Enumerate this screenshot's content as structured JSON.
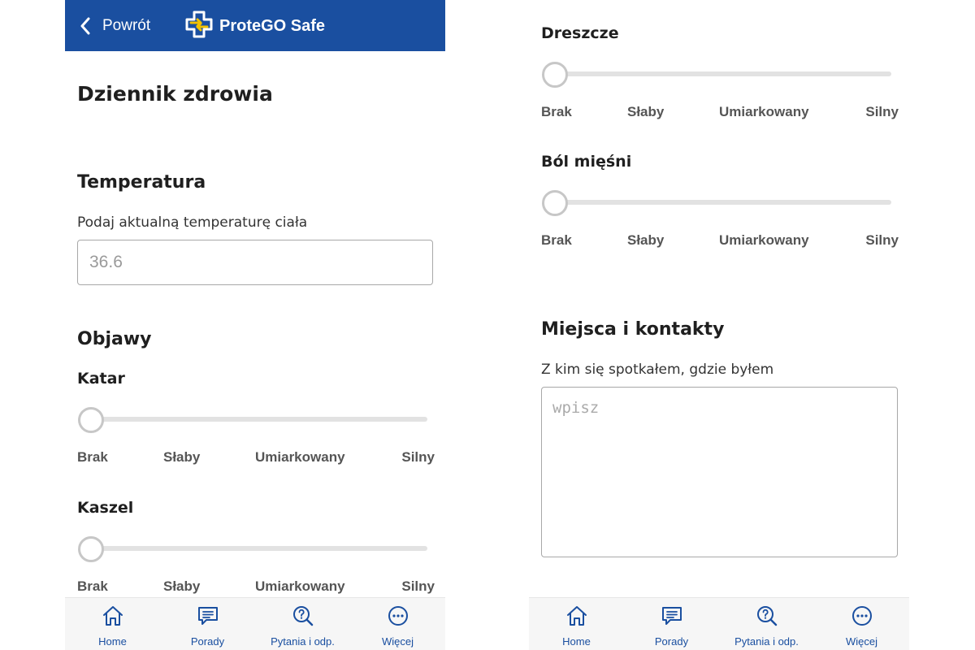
{
  "header": {
    "back_label": "Powrót",
    "logo_text": "ProteGO Safe"
  },
  "page": {
    "title": "Dziennik zdrowia"
  },
  "temperature": {
    "title": "Temperatura",
    "description": "Podaj aktualną temperaturę ciała",
    "placeholder": "36.6",
    "value": ""
  },
  "symptoms": {
    "title": "Objawy",
    "levels": [
      "Brak",
      "Słaby",
      "Umiarkowany",
      "Silny"
    ],
    "items": [
      {
        "name": "Katar",
        "level": 0
      },
      {
        "name": "Kaszel",
        "level": 0
      },
      {
        "name": "Dreszcze",
        "level": 0
      },
      {
        "name": "Ból mięśni",
        "level": 0
      }
    ]
  },
  "contacts": {
    "title": "Miejsca i kontakty",
    "description": "Z kim się spotkałem, gdzie byłem",
    "placeholder": "wpisz",
    "value": ""
  },
  "tabs": [
    {
      "label": "Home",
      "icon": "home-icon"
    },
    {
      "label": "Porady",
      "icon": "chat-icon"
    },
    {
      "label": "Pytania i odp.",
      "icon": "question-search-icon"
    },
    {
      "label": "Więcej",
      "icon": "more-icon"
    }
  ],
  "colors": {
    "brand_blue": "#1a4fa0",
    "logo_yellow": "#f2c200",
    "slider_track": "#e2e2e2",
    "tab_bar_bg": "#f6f6f6"
  }
}
